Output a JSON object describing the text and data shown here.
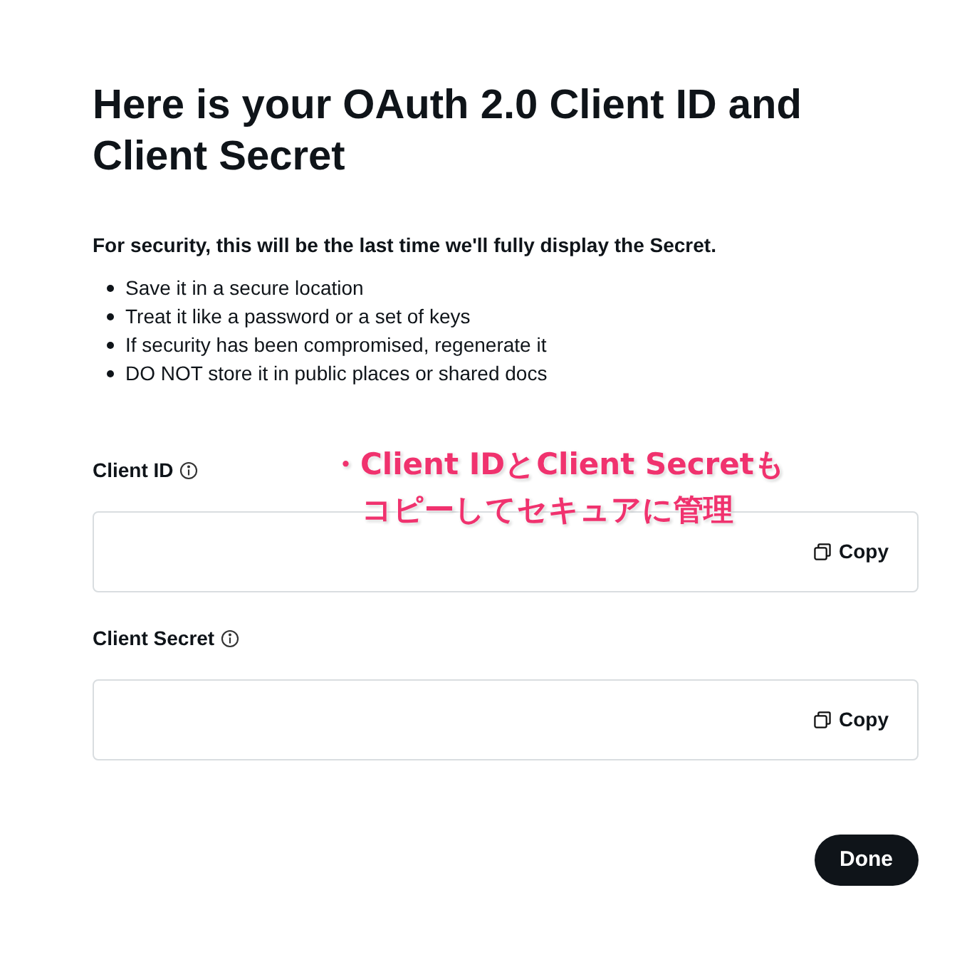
{
  "title": "Here is your OAuth 2.0 Client ID and Client Secret",
  "notice": "For security, this will be the last time we'll fully display the Secret.",
  "tips": [
    "Save it in a secure location",
    "Treat it like a password or a set of keys",
    "If security has been compromised, regenerate it",
    "DO NOT store it in public places or shared docs"
  ],
  "fields": [
    {
      "label": "Client ID",
      "copy": "Copy"
    },
    {
      "label": "Client Secret",
      "copy": "Copy"
    }
  ],
  "annotation": [
    "・Client IDとClient Secretも",
    "コピーしてセキュアに管理"
  ],
  "done_button": "Done"
}
